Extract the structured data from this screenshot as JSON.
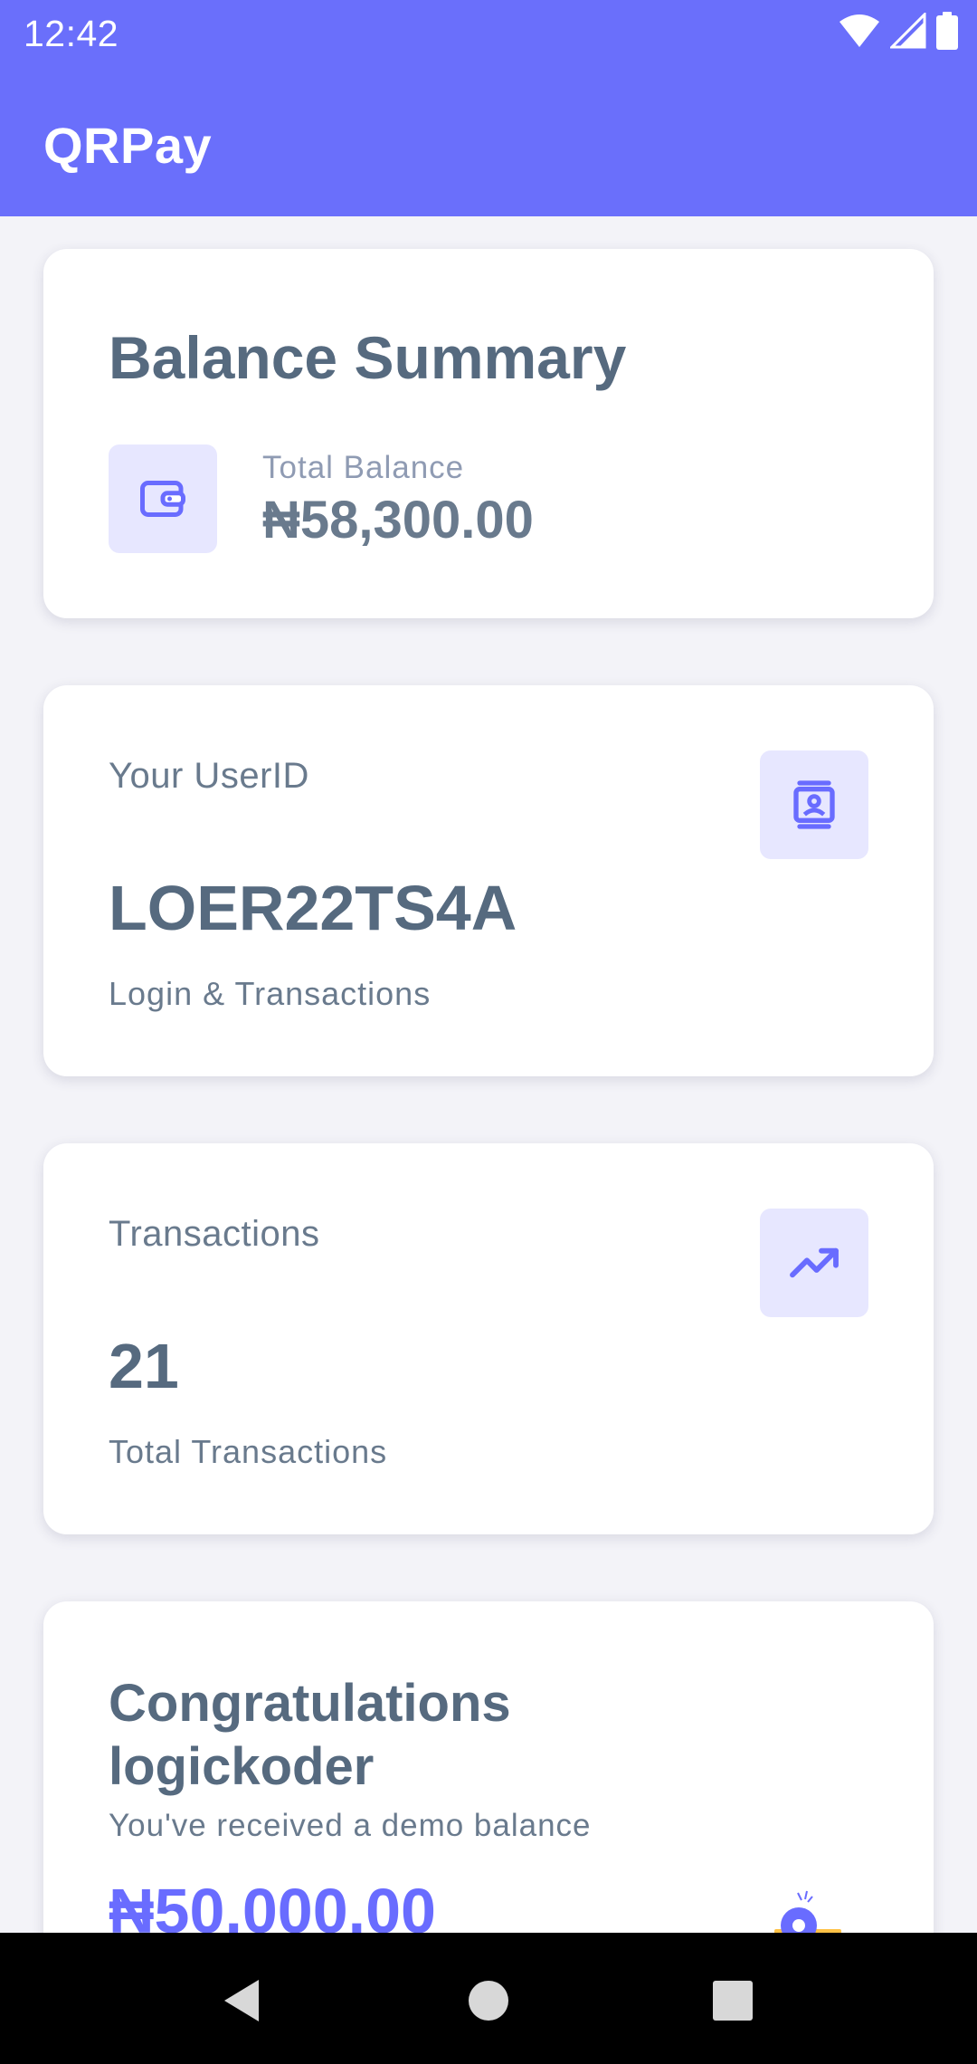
{
  "status_bar": {
    "time": "12:42",
    "icons": [
      "wifi-icon",
      "signal-icon",
      "battery-icon"
    ]
  },
  "app_bar": {
    "title": "QRPay"
  },
  "balance_card": {
    "title": "Balance Summary",
    "icon": "wallet-icon",
    "label": "Total Balance",
    "value": "₦58,300.00"
  },
  "user_card": {
    "label": "Your UserID",
    "icon": "contact-card-icon",
    "value": "LOER22TS4A",
    "caption": "Login & Transactions"
  },
  "transactions_card": {
    "label": "Transactions",
    "icon": "trending-up-icon",
    "value": "21",
    "caption": "Total Transactions"
  },
  "congrats_card": {
    "title": "Congratulations logickoder",
    "subtitle": "You've received a demo balance",
    "amount": "₦50,000.00",
    "illustration": "reward-illustration"
  },
  "nav_bar": {
    "buttons": [
      "back-icon",
      "home-icon",
      "recents-icon"
    ]
  },
  "colors": {
    "primary": "#696cff",
    "app_bar": "#6a6ffb",
    "icon_bg": "#e7e7ff",
    "text": "#566a7f",
    "background": "#f3f3f8"
  }
}
